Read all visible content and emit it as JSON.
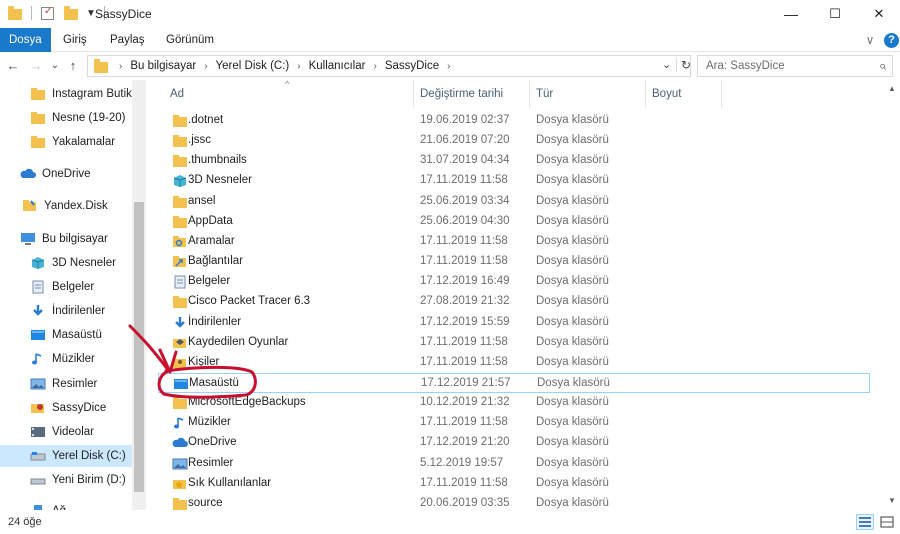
{
  "window": {
    "title": "SassyDice",
    "minimize": "—",
    "maximize": "☐",
    "close": "✕"
  },
  "ribbon": {
    "tabs": [
      "Dosya",
      "Giriş",
      "Paylaş",
      "Görünüm"
    ],
    "expand": "∨",
    "help": "?"
  },
  "nav": {
    "back": "←",
    "forward": "→",
    "recent": "⌄",
    "up": "↑",
    "breadcrumb": [
      "Bu bilgisayar",
      "Yerel Disk (C:)",
      "Kullanıcılar",
      "SassyDice"
    ],
    "dropdown": "⌄",
    "refresh": "↻"
  },
  "search": {
    "placeholder": "Ara: SassyDice",
    "icon": "⌕"
  },
  "sidebar": [
    {
      "label": "Instagram Butik",
      "icon": "folder-icon"
    },
    {
      "label": "Nesne (19-20)",
      "icon": "folder-icon"
    },
    {
      "label": "Yakalamalar",
      "icon": "folder-icon"
    },
    {
      "label": "OneDrive",
      "icon": "cloud-icon"
    },
    {
      "label": "Yandex.Disk",
      "icon": "yandex-disk-icon"
    },
    {
      "label": "Bu bilgisayar",
      "icon": "computer-icon"
    },
    {
      "label": "3D Nesneler",
      "icon": "cube-icon"
    },
    {
      "label": "Belgeler",
      "icon": "document-icon"
    },
    {
      "label": "İndirilenler",
      "icon": "download-icon"
    },
    {
      "label": "Masaüstü",
      "icon": "desktop-icon"
    },
    {
      "label": "Müzikler",
      "icon": "music-icon"
    },
    {
      "label": "Resimler",
      "icon": "pictures-icon"
    },
    {
      "label": "SassyDice",
      "icon": "user-icon"
    },
    {
      "label": "Videolar",
      "icon": "video-icon"
    },
    {
      "label": "Yerel Disk (C:)",
      "icon": "disk-icon",
      "selected": true
    },
    {
      "label": "Yeni Birim (D:)",
      "icon": "drive-icon"
    },
    {
      "label": "Ağ",
      "icon": "network-icon"
    }
  ],
  "columns": {
    "name": "Ad",
    "modified": "Değiştirme tarihi",
    "type": "Tür",
    "size": "Boyut"
  },
  "files": [
    {
      "name": ".dotnet",
      "modified": "19.06.2019 02:37",
      "type": "Dosya klasörü",
      "icon": "folder-icon"
    },
    {
      "name": ".jssc",
      "modified": "21.06.2019 07:20",
      "type": "Dosya klasörü",
      "icon": "folder-icon"
    },
    {
      "name": ".thumbnails",
      "modified": "31.07.2019 04:34",
      "type": "Dosya klasörü",
      "icon": "folder-icon"
    },
    {
      "name": "3D Nesneler",
      "modified": "17.11.2019 11:58",
      "type": "Dosya klasörü",
      "icon": "cube-icon"
    },
    {
      "name": "ansel",
      "modified": "25.06.2019 03:34",
      "type": "Dosya klasörü",
      "icon": "folder-icon"
    },
    {
      "name": "AppData",
      "modified": "25.06.2019 04:30",
      "type": "Dosya klasörü",
      "icon": "folder-icon"
    },
    {
      "name": "Aramalar",
      "modified": "17.11.2019 11:58",
      "type": "Dosya klasörü",
      "icon": "search-folder-icon"
    },
    {
      "name": "Bağlantılar",
      "modified": "17.11.2019 11:58",
      "type": "Dosya klasörü",
      "icon": "links-folder-icon"
    },
    {
      "name": "Belgeler",
      "modified": "17.12.2019 16:49",
      "type": "Dosya klasörü",
      "icon": "document-icon"
    },
    {
      "name": "Cisco Packet Tracer 6.3",
      "modified": "27.08.2019 21:32",
      "type": "Dosya klasörü",
      "icon": "folder-icon"
    },
    {
      "name": "İndirilenler",
      "modified": "17.12.2019 15:59",
      "type": "Dosya klasörü",
      "icon": "download-icon"
    },
    {
      "name": "Kaydedilen Oyunlar",
      "modified": "17.11.2019 11:58",
      "type": "Dosya klasörü",
      "icon": "saved-games-icon"
    },
    {
      "name": "Kişiler",
      "modified": "17.11.2019 11:58",
      "type": "Dosya klasörü",
      "icon": "contacts-icon"
    },
    {
      "name": "Masaüstü",
      "modified": "17.12.2019 21:57",
      "type": "Dosya klasörü",
      "icon": "desktop-icon",
      "focused": true
    },
    {
      "name": "MicrosoftEdgeBackups",
      "modified": "10.12.2019 21:32",
      "type": "Dosya klasörü",
      "icon": "folder-icon"
    },
    {
      "name": "Müzikler",
      "modified": "17.11.2019 11:58",
      "type": "Dosya klasörü",
      "icon": "music-icon"
    },
    {
      "name": "OneDrive",
      "modified": "17.12.2019 21:20",
      "type": "Dosya klasörü",
      "icon": "cloud-icon"
    },
    {
      "name": "Resimler",
      "modified": "5.12.2019 19:57",
      "type": "Dosya klasörü",
      "icon": "pictures-icon"
    },
    {
      "name": "Sık Kullanılanlar",
      "modified": "17.11.2019 11:58",
      "type": "Dosya klasörü",
      "icon": "favorites-icon"
    },
    {
      "name": "source",
      "modified": "20.06.2019 03:35",
      "type": "Dosya klasörü",
      "icon": "folder-icon"
    }
  ],
  "status": {
    "count": "24 öğe"
  },
  "colors": {
    "accent": "#1979ca",
    "folder": "#f2c14e",
    "selection": "#cce8ff",
    "annotation": "#c8102e"
  }
}
